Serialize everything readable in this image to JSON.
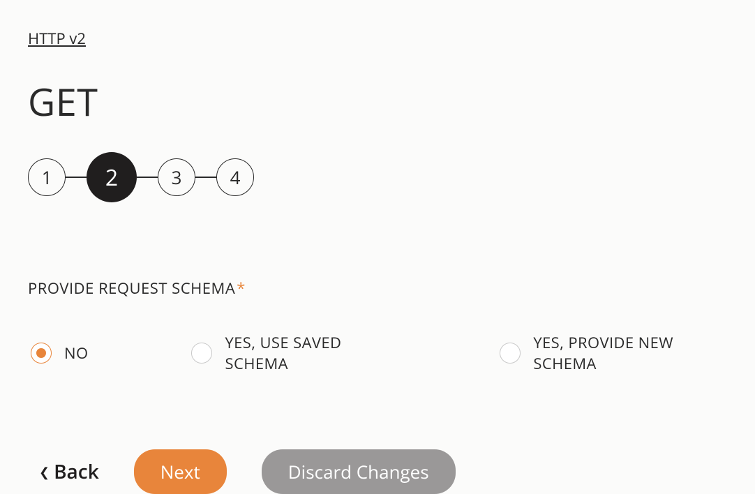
{
  "breadcrumb": "HTTP v2",
  "title": "GET",
  "stepper": {
    "steps": [
      "1",
      "2",
      "3",
      "4"
    ],
    "activeIndex": 1
  },
  "schemaField": {
    "label": "PROVIDE REQUEST SCHEMA",
    "required": "*",
    "options": [
      {
        "label": "NO",
        "selected": true
      },
      {
        "label": "YES, USE SAVED SCHEMA",
        "selected": false
      },
      {
        "label": "YES, PROVIDE NEW SCHEMA",
        "selected": false
      }
    ]
  },
  "buttons": {
    "back": "Back",
    "next": "Next",
    "discard": "Discard Changes"
  }
}
